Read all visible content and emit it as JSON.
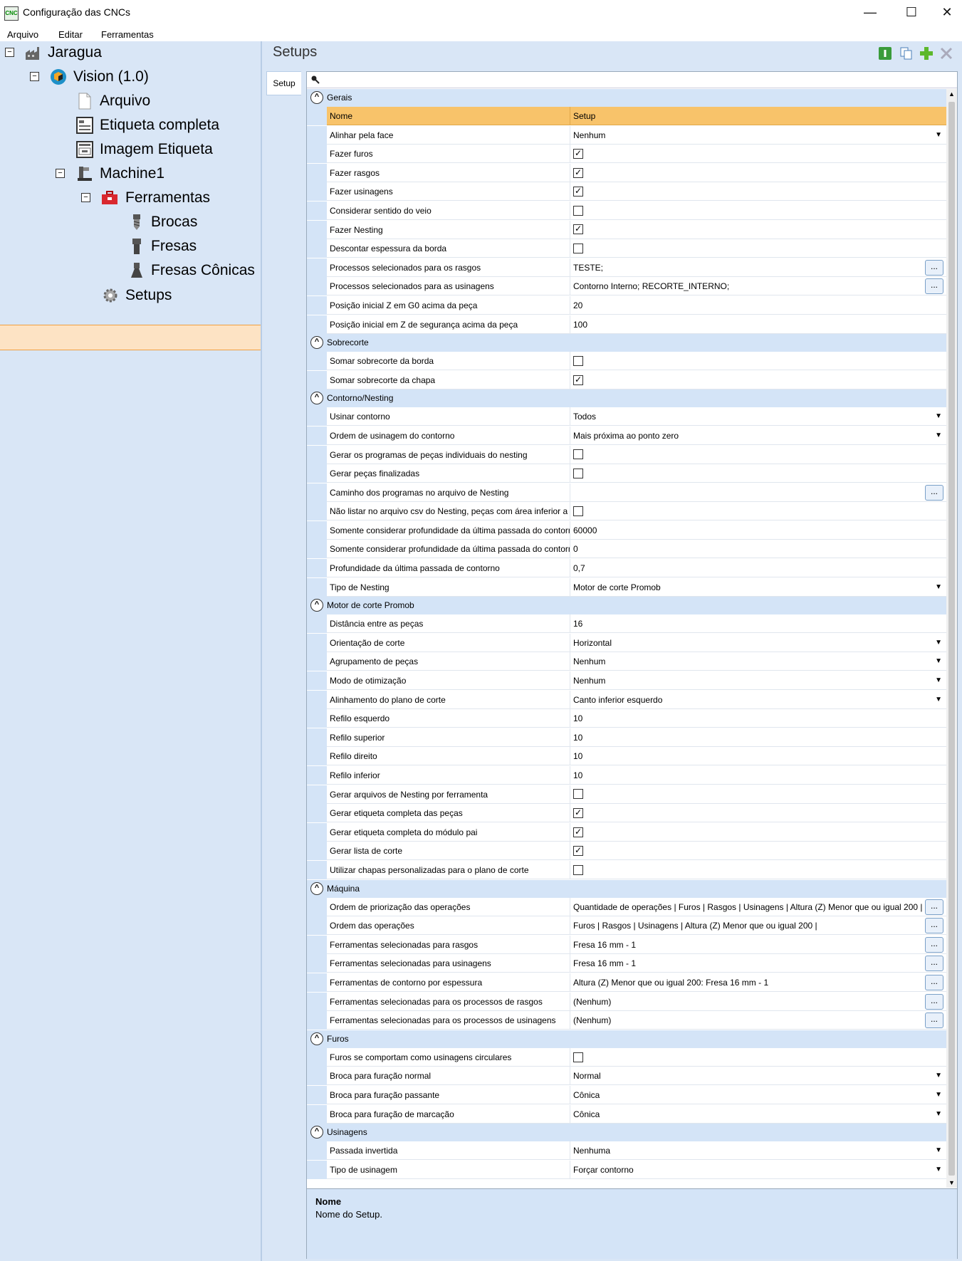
{
  "window": {
    "title": "Configuração das CNCs",
    "icon_text": "CNC",
    "minimize": "—",
    "maximize": "☐",
    "close": "✕"
  },
  "menu": [
    "Arquivo",
    "Editar",
    "Ferramentas"
  ],
  "tree": {
    "root": "Jaragua",
    "vision": "Vision (1.0)",
    "arquivo": "Arquivo",
    "etiqueta_completa": "Etiqueta completa",
    "imagem_etiqueta": "Imagem Etiqueta",
    "machine": "Machine1",
    "ferramentas": "Ferramentas",
    "brocas": "Brocas",
    "fresas": "Fresas",
    "fresas_conicas": "Fresas Cônicas",
    "setups": "Setups"
  },
  "panel": {
    "title": "Setups",
    "tab": "Setup"
  },
  "grid": {
    "header": {
      "name": "Nome",
      "value": "Setup"
    },
    "categories": [
      {
        "label": "Gerais",
        "rows": [
          {
            "name": "Alinhar pela face",
            "value": "Nenhum",
            "kind": "dropdown"
          },
          {
            "name": "Fazer furos",
            "value": "true",
            "kind": "check"
          },
          {
            "name": "Fazer rasgos",
            "value": "true",
            "kind": "check"
          },
          {
            "name": "Fazer usinagens",
            "value": "true",
            "kind": "check"
          },
          {
            "name": "Considerar sentido do veio",
            "value": "false",
            "kind": "check"
          },
          {
            "name": "Fazer Nesting",
            "value": "true",
            "kind": "check"
          },
          {
            "name": "Descontar espessura da borda",
            "value": "false",
            "kind": "check"
          },
          {
            "name": "Processos selecionados para os rasgos",
            "value": "TESTE;",
            "kind": "ellipsis"
          },
          {
            "name": "Processos selecionados para as usinagens",
            "value": "Contorno Interno; RECORTE_INTERNO;",
            "kind": "ellipsis"
          },
          {
            "name": "Posição inicial Z em G0 acima da peça",
            "value": "20",
            "kind": "text"
          },
          {
            "name": "Posição inicial em Z de segurança acima da peça",
            "value": "100",
            "kind": "text"
          }
        ]
      },
      {
        "label": "Sobrecorte",
        "rows": [
          {
            "name": "Somar sobrecorte da borda",
            "value": "false",
            "kind": "check"
          },
          {
            "name": "Somar sobrecorte da chapa",
            "value": "true",
            "kind": "check"
          }
        ]
      },
      {
        "label": "Contorno/Nesting",
        "rows": [
          {
            "name": "Usinar contorno",
            "value": "Todos",
            "kind": "dropdown"
          },
          {
            "name": "Ordem de usinagem do contorno",
            "value": "Mais próxima ao ponto zero",
            "kind": "dropdown"
          },
          {
            "name": "Gerar os programas de peças individuais do nesting",
            "value": "false",
            "kind": "check"
          },
          {
            "name": "Gerar peças finalizadas",
            "value": "false",
            "kind": "check"
          },
          {
            "name": "Caminho dos programas no arquivo de Nesting",
            "value": "",
            "kind": "ellipsis"
          },
          {
            "name": "Não listar no arquivo csv do Nesting, peças com área inferior a",
            "value": "false",
            "kind": "check"
          },
          {
            "name": "Somente considerar profundidade da última passada do contorno",
            "value": "60000",
            "kind": "text"
          },
          {
            "name": "Somente considerar profundidade da última passada do contorno",
            "value": "0",
            "kind": "text"
          },
          {
            "name": "Profundidade da última passada de contorno",
            "value": "0,7",
            "kind": "text"
          },
          {
            "name": "Tipo de Nesting",
            "value": "Motor de corte Promob",
            "kind": "dropdown"
          }
        ]
      },
      {
        "label": "Motor de corte Promob",
        "rows": [
          {
            "name": "Distância entre as peças",
            "value": "16",
            "kind": "text"
          },
          {
            "name": "Orientação de corte",
            "value": "Horizontal",
            "kind": "dropdown"
          },
          {
            "name": "Agrupamento de peças",
            "value": "Nenhum",
            "kind": "dropdown"
          },
          {
            "name": "Modo de otimização",
            "value": "Nenhum",
            "kind": "dropdown"
          },
          {
            "name": "Alinhamento do plano de corte",
            "value": "Canto inferior esquerdo",
            "kind": "dropdown"
          },
          {
            "name": "Refilo esquerdo",
            "value": "10",
            "kind": "text"
          },
          {
            "name": "Refilo superior",
            "value": "10",
            "kind": "text"
          },
          {
            "name": "Refilo direito",
            "value": "10",
            "kind": "text"
          },
          {
            "name": "Refilo inferior",
            "value": "10",
            "kind": "text"
          },
          {
            "name": "Gerar arquivos de Nesting por ferramenta",
            "value": "false",
            "kind": "check"
          },
          {
            "name": "Gerar etiqueta completa das peças",
            "value": "true",
            "kind": "check"
          },
          {
            "name": "Gerar etiqueta completa do módulo pai",
            "value": "true",
            "kind": "check"
          },
          {
            "name": "Gerar lista de corte",
            "value": "true",
            "kind": "check"
          },
          {
            "name": "Utilizar chapas personalizadas para o plano de corte",
            "value": "false",
            "kind": "check"
          }
        ]
      },
      {
        "label": "Máquina",
        "rows": [
          {
            "name": "Ordem de priorização das operações",
            "value": "Quantidade de operações | Furos | Rasgos | Usinagens | Altura (Z) Menor que ou igual 200 |",
            "kind": "ellipsis"
          },
          {
            "name": "Ordem das operações",
            "value": "Furos | Rasgos | Usinagens | Altura (Z) Menor que ou igual 200 |",
            "kind": "ellipsis"
          },
          {
            "name": "Ferramentas selecionadas para rasgos",
            "value": "Fresa 16 mm - 1",
            "kind": "ellipsis"
          },
          {
            "name": "Ferramentas selecionadas para usinagens",
            "value": "Fresa 16 mm - 1",
            "kind": "ellipsis"
          },
          {
            "name": "Ferramentas de contorno por espessura",
            "value": "Altura (Z) Menor que ou igual 200: Fresa 16 mm - 1",
            "kind": "ellipsis"
          },
          {
            "name": "Ferramentas selecionadas para os processos de rasgos",
            "value": "(Nenhum)",
            "kind": "ellipsis"
          },
          {
            "name": "Ferramentas selecionadas para os processos de usinagens",
            "value": "(Nenhum)",
            "kind": "ellipsis"
          }
        ]
      },
      {
        "label": "Furos",
        "rows": [
          {
            "name": "Furos se comportam como usinagens circulares",
            "value": "false",
            "kind": "check"
          },
          {
            "name": "Broca para furação normal",
            "value": "Normal",
            "kind": "dropdown"
          },
          {
            "name": "Broca para furação passante",
            "value": "Cônica",
            "kind": "dropdown"
          },
          {
            "name": "Broca para furação de marcação",
            "value": "Cônica",
            "kind": "dropdown"
          }
        ]
      },
      {
        "label": "Usinagens",
        "rows": [
          {
            "name": "Passada invertida",
            "value": "Nenhuma",
            "kind": "dropdown"
          },
          {
            "name": "Tipo de usinagem",
            "value": "Forçar contorno",
            "kind": "dropdown"
          }
        ]
      }
    ]
  },
  "description": {
    "title": "Nome",
    "text": "Nome do Setup."
  }
}
